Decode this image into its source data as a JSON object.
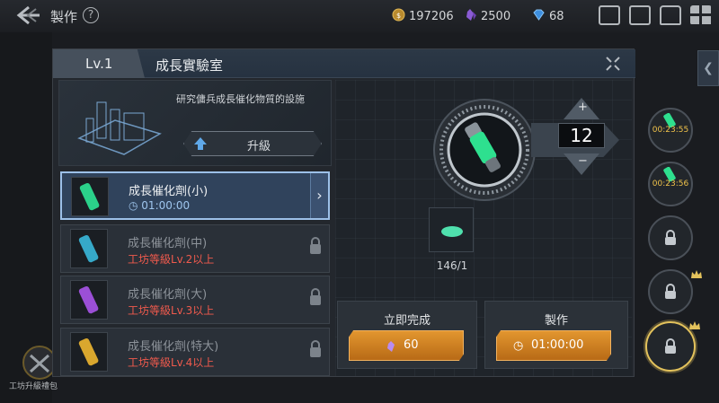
{
  "topbar": {
    "title": "製作",
    "help": "?",
    "resources": [
      {
        "icon": "coin-icon",
        "value": "197206"
      },
      {
        "icon": "crystal-icon",
        "value": "2500"
      },
      {
        "icon": "diamond-icon",
        "value": "68"
      }
    ]
  },
  "panel": {
    "level_tab": "Lv.1",
    "title": "成長實驗室"
  },
  "facility": {
    "description": "研究傭兵成長催化物質的設施",
    "upgrade_label": "升級"
  },
  "items": [
    {
      "name": "成長催化劑(小)",
      "sub": "01:00:00",
      "selected": true,
      "locked": false
    },
    {
      "name": "成長催化劑(中)",
      "sub": "工坊等級Lv.2以上",
      "selected": false,
      "locked": true
    },
    {
      "name": "成長催化劑(大)",
      "sub": "工坊等級Lv.3以上",
      "selected": false,
      "locked": true
    },
    {
      "name": "成長催化劑(特大)",
      "sub": "工坊等級Lv.4以上",
      "selected": false,
      "locked": true
    }
  ],
  "stepper": {
    "quantity": "12",
    "plus": "+",
    "minus": "−"
  },
  "material": {
    "count": "146/1"
  },
  "actions": {
    "instant": {
      "caption": "立即完成",
      "cost": "60"
    },
    "craft": {
      "caption": "製作",
      "time": "01:00:00"
    }
  },
  "sidebar": {
    "tab_glyph": "❮",
    "slots": [
      {
        "timer": "00:23:55"
      },
      {
        "timer": "00:23:56"
      }
    ]
  },
  "bottom_badge": {
    "label": "工坊升級禮包"
  },
  "colors": {
    "accent_blue": "#9cc0e8",
    "warning_red": "#f05a4d",
    "button_orange": "#e2962f",
    "timer_gold": "#f0c24a"
  }
}
